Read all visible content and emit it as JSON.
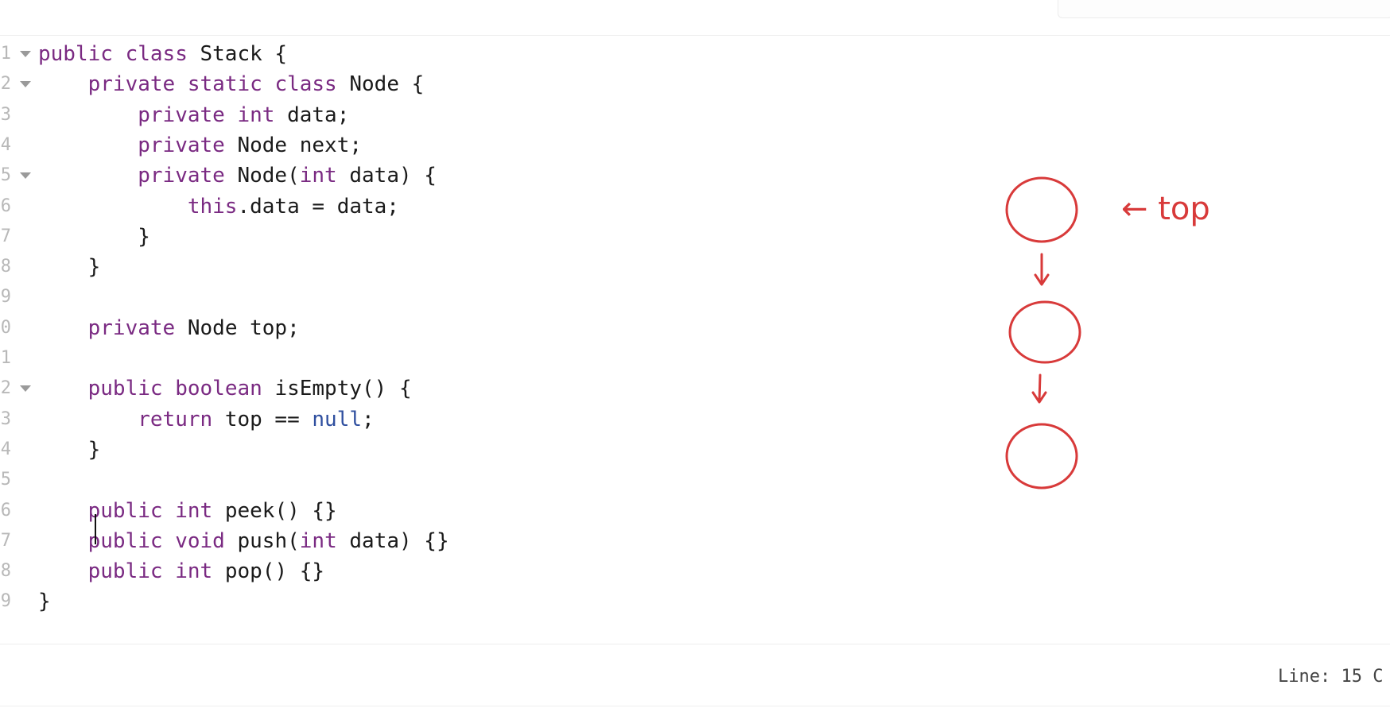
{
  "editor": {
    "lines": [
      {
        "num": "1",
        "fold": true,
        "tokens": [
          [
            "kw",
            "public "
          ],
          [
            "kw",
            "class "
          ],
          [
            "t",
            "Stack {"
          ]
        ]
      },
      {
        "num": "2",
        "fold": true,
        "tokens": [
          [
            "t",
            "    "
          ],
          [
            "kw",
            "private "
          ],
          [
            "kw",
            "static "
          ],
          [
            "kw",
            "class "
          ],
          [
            "t",
            "Node {"
          ]
        ]
      },
      {
        "num": "3",
        "fold": false,
        "tokens": [
          [
            "t",
            "        "
          ],
          [
            "kw",
            "private "
          ],
          [
            "kw",
            "int "
          ],
          [
            "t",
            "data;"
          ]
        ]
      },
      {
        "num": "4",
        "fold": false,
        "tokens": [
          [
            "t",
            "        "
          ],
          [
            "kw",
            "private "
          ],
          [
            "t",
            "Node next;"
          ]
        ]
      },
      {
        "num": "5",
        "fold": true,
        "tokens": [
          [
            "t",
            "        "
          ],
          [
            "kw",
            "private "
          ],
          [
            "t",
            "Node("
          ],
          [
            "kw",
            "int "
          ],
          [
            "t",
            "data) {"
          ]
        ]
      },
      {
        "num": "6",
        "fold": false,
        "tokens": [
          [
            "t",
            "            "
          ],
          [
            "kw",
            "this"
          ],
          [
            "t",
            ".data = data;"
          ]
        ]
      },
      {
        "num": "7",
        "fold": false,
        "tokens": [
          [
            "t",
            "        }"
          ]
        ]
      },
      {
        "num": "8",
        "fold": false,
        "tokens": [
          [
            "t",
            "    }"
          ]
        ]
      },
      {
        "num": "9",
        "fold": false,
        "tokens": []
      },
      {
        "num": "0",
        "fold": false,
        "tokens": [
          [
            "t",
            "    "
          ],
          [
            "kw",
            "private "
          ],
          [
            "t",
            "Node top;"
          ]
        ]
      },
      {
        "num": "1",
        "fold": false,
        "tokens": []
      },
      {
        "num": "2",
        "fold": true,
        "tokens": [
          [
            "t",
            "    "
          ],
          [
            "kw",
            "public "
          ],
          [
            "kw",
            "boolean "
          ],
          [
            "t",
            "isEmpty() {"
          ]
        ]
      },
      {
        "num": "3",
        "fold": false,
        "tokens": [
          [
            "t",
            "        "
          ],
          [
            "kw",
            "return "
          ],
          [
            "t",
            "top == "
          ],
          [
            "kw2",
            "null"
          ],
          [
            "t",
            ";"
          ]
        ]
      },
      {
        "num": "4",
        "fold": false,
        "tokens": [
          [
            "t",
            "    }"
          ]
        ]
      },
      {
        "num": "5",
        "fold": false,
        "tokens": []
      },
      {
        "num": "6",
        "fold": false,
        "tokens": [
          [
            "t",
            "    "
          ],
          [
            "kw",
            "public "
          ],
          [
            "kw",
            "int "
          ],
          [
            "t",
            "peek() {}"
          ]
        ]
      },
      {
        "num": "7",
        "fold": false,
        "tokens": [
          [
            "t",
            "    "
          ],
          [
            "kw",
            "public "
          ],
          [
            "kw",
            "void "
          ],
          [
            "t",
            "push("
          ],
          [
            "kw",
            "int "
          ],
          [
            "t",
            "data) {}"
          ]
        ]
      },
      {
        "num": "8",
        "fold": false,
        "tokens": [
          [
            "t",
            "    "
          ],
          [
            "kw",
            "public "
          ],
          [
            "kw",
            "int "
          ],
          [
            "t",
            "pop() {}"
          ]
        ]
      },
      {
        "num": "9",
        "fold": false,
        "tokens": [
          [
            "t",
            "}"
          ]
        ]
      }
    ]
  },
  "drawing": {
    "top_label": "← top",
    "stroke_color": "#d83a3a",
    "node_count": 3
  },
  "status": {
    "cursor_position": "Line: 15 C"
  }
}
